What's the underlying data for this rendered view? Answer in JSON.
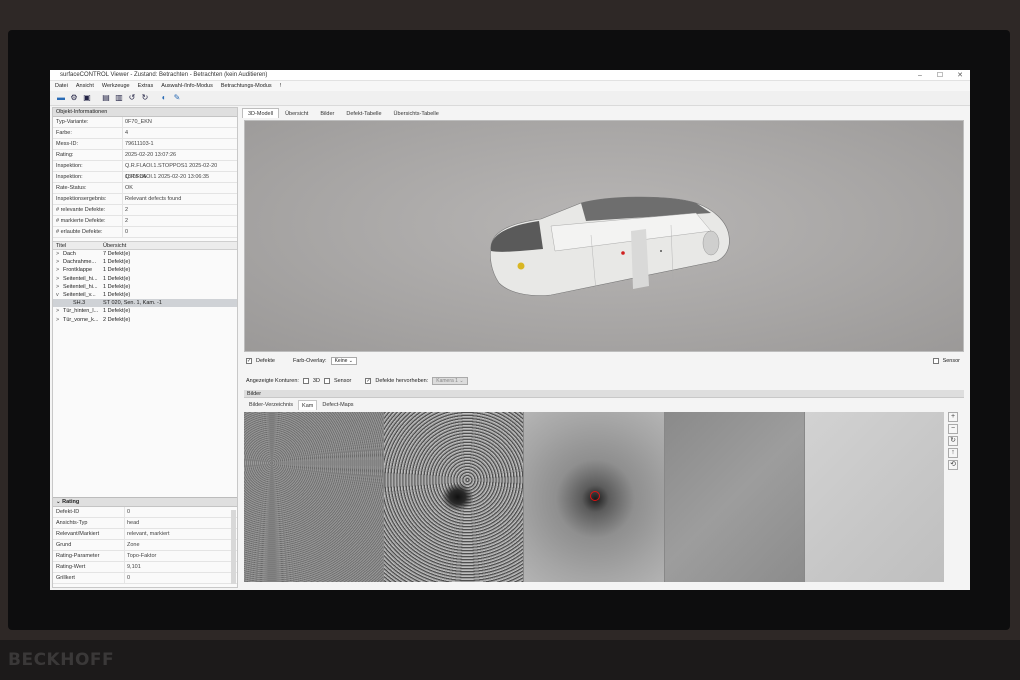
{
  "window": {
    "title": "surfaceCONTROL Viewer - Zustand: Betrachten - Betrachten (kein Auditieren)",
    "minimize": "–",
    "maximize": "☐",
    "close": "✕"
  },
  "menu": [
    "Datei",
    "Ansicht",
    "Werkzeuge",
    "Extras",
    "Auswahl-/Info-Modus",
    "Betrachtungs-Modus",
    "!"
  ],
  "toolbar_icons": [
    "open-folder-icon",
    "settings-icon",
    "save-icon",
    "print-icon",
    "export-icon",
    "undo-icon",
    "redo-icon",
    "view-icon",
    "tool-icon"
  ],
  "objekt": {
    "heading": "Objekt-Informationen",
    "rows": [
      {
        "k": "Typ-Variante:",
        "v": "0F70_EKN"
      },
      {
        "k": "Farbe:",
        "v": "4"
      },
      {
        "k": "Mess-ID:",
        "v": "79611103-1"
      },
      {
        "k": "Rating:",
        "v": "2025-02-20 13:07:26"
      },
      {
        "k": "Inspektion:",
        "v": "Q.R.Fl.AOI.1.STOPPOS1 2025-02-20 13:05:35"
      },
      {
        "k": "Inspektion:",
        "v": "Q.R.Fl.AOI.1 2025-02-20 13:06:35"
      },
      {
        "k": "Rate-Status:",
        "v": "OK"
      },
      {
        "k": "Inspektionsergebnis:",
        "v": "Relevant defects found"
      },
      {
        "k": "# relevante Defekte:",
        "v": "2"
      },
      {
        "k": "# markierte Defekte:",
        "v": "2"
      },
      {
        "k": "# erlaubte Defekte:",
        "v": "0"
      }
    ]
  },
  "tree": {
    "col_title": "Titel",
    "col_overview": "Übersicht",
    "rows": [
      {
        "chev": ">",
        "title": "Dach",
        "ov": "7 Defekt(e)"
      },
      {
        "chev": ">",
        "title": "Dachrahme...",
        "ov": "1 Defekt(e)"
      },
      {
        "chev": ">",
        "title": "Frontklappe",
        "ov": "1 Defekt(e)"
      },
      {
        "chev": ">",
        "title": "Seitenteil_hi...",
        "ov": "1 Defekt(e)"
      },
      {
        "chev": ">",
        "title": "Seitenteil_hi...",
        "ov": "1 Defekt(e)"
      },
      {
        "chev": "v",
        "title": "Seitenteil_v...",
        "ov": "1 Defekt(e)"
      },
      {
        "chev": "",
        "title": "SH.3",
        "ov": "ST 020, Sen. 1, Kam. -1"
      },
      {
        "chev": ">",
        "title": "Tür_hinten_l...",
        "ov": "1 Defekt(e)"
      },
      {
        "chev": ">",
        "title": "Tür_vorne_k...",
        "ov": "2 Defekt(e)"
      }
    ]
  },
  "rating": {
    "heading": "Rating",
    "rows": [
      {
        "k": "Defekt-ID",
        "v": "0"
      },
      {
        "k": "Ansichts-Typ",
        "v": "head"
      },
      {
        "k": "Relevant/Markiert",
        "v": "relevant, markiert"
      },
      {
        "k": "Grund",
        "v": "Zone"
      },
      {
        "k": "Rating-Parameter",
        "v": "Topo-Faktor"
      },
      {
        "k": "Rating-Wert",
        "v": "9,101"
      },
      {
        "k": "Grillkert",
        "v": "0"
      }
    ]
  },
  "tabs": [
    "3D-Modell",
    "Übersicht",
    "Bilder",
    "Defekt-Tabelle",
    "Übersichts-Tabelle"
  ],
  "viewport_options": {
    "defekte": "Defekte",
    "farb_overlay": "Farb-Overlay:",
    "farb_value": "Keine",
    "sensor": "Sensor"
  },
  "kontur_options": {
    "label": "Angezeigte Konturen:",
    "k3d": "3D",
    "sensor": "Sensor",
    "hervorheben": "Defekte hervorheben:",
    "kamera": "Kamera 1"
  },
  "bilder": {
    "heading": "Bilder",
    "tabs": [
      "Bilder-Verzeichnis",
      "Kam",
      "Defect-Maps"
    ]
  },
  "zoom_icons": [
    "zoom-in-icon",
    "zoom-out-icon",
    "rotate-icon",
    "move-up-icon",
    "reset-icon"
  ],
  "brand": "BECKHOFF"
}
